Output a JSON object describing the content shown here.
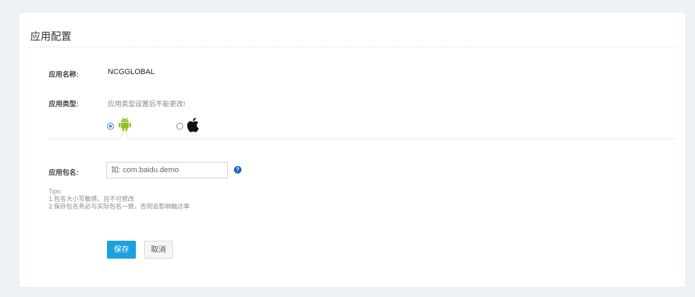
{
  "card": {
    "title": "应用配置"
  },
  "app_name": {
    "label": "应用名称:",
    "value": "NCGGLOBAL"
  },
  "app_type": {
    "label": "应用类型:",
    "hint": "应用类型设置后不能更改!",
    "options": [
      {
        "icon": "android-icon",
        "color": "#8fbf20",
        "selected": true
      },
      {
        "icon": "apple-icon",
        "color": "#111111",
        "selected": false
      }
    ]
  },
  "package": {
    "label": "应用包名:",
    "value": "",
    "placeholder": "如: com.baidu.demo"
  },
  "tips": {
    "title": "Tips:",
    "lines": [
      "1.包名大小写敏感，且不可修改",
      "2.保存包名务必与实际包名一致，否则会影响触达率"
    ]
  },
  "actions": {
    "save_label": "保存",
    "cancel_label": "取消"
  },
  "colors": {
    "accent": "#1ba1e2",
    "radio": "#2f7fe8",
    "help": "#1b66c9"
  }
}
